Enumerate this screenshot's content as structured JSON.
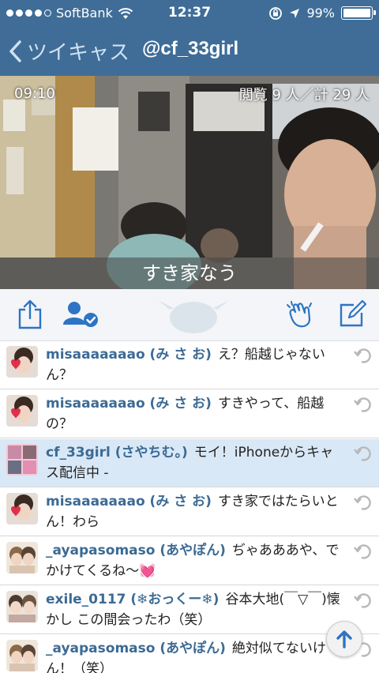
{
  "status_bar": {
    "carrier": "SoftBank",
    "time": "12:37",
    "battery": "99%",
    "battery_level": 0.99,
    "signal_bars": 4,
    "signal_total": 5
  },
  "nav": {
    "back_label": "ツイキャス",
    "title": "@cf_33girl"
  },
  "video": {
    "elapsed": "09:10",
    "viewers": "閲覧 9 人／計 29 人",
    "caption": "すき家なう"
  },
  "toolbar": {
    "icons": [
      "share-icon",
      "follow-check-icon",
      "clap-icon",
      "compose-icon"
    ]
  },
  "comments": [
    {
      "name": "misaaaaaaao (み さ お)",
      "text": "え？船越じゃないん？",
      "self": false
    },
    {
      "name": "misaaaaaaao (み さ お)",
      "text": "すきやって、船越の？",
      "self": false
    },
    {
      "name": "cf_33girl (さやちむ。)",
      "text": "モイ！iPhoneからキャス配信中 -",
      "self": true
    },
    {
      "name": "misaaaaaaao (み さ お)",
      "text": "すき家ではたらいとん！わら",
      "self": false
    },
    {
      "name": "_ayapasomaso (あやぽん)",
      "text": "ぢゃあああや、でかけてくるね〜💓",
      "self": false
    },
    {
      "name": "exile_0117 (❄おっくー❄)",
      "text": "谷本大地(￣▽￣)懐かし この間会ったわ（笑）",
      "self": false
    },
    {
      "name": "_ayapasomaso (あやぽん)",
      "text": "絶対似てないけん！（笑）",
      "self": false
    }
  ],
  "colors": {
    "header": "#3f6d97",
    "accent": "#2e74c4",
    "self_row": "#d9e8f6",
    "username": "#3c6a94"
  }
}
